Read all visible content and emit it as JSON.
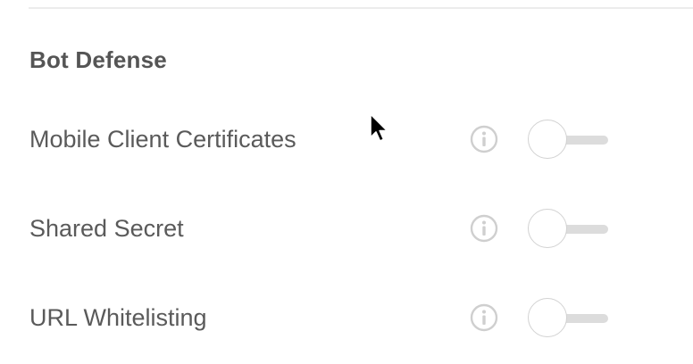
{
  "section": {
    "title": "Bot Defense"
  },
  "settings": [
    {
      "label": "Mobile Client Certificates",
      "enabled": false,
      "info_icon": "info-circle-icon"
    },
    {
      "label": "Shared Secret",
      "enabled": false,
      "info_icon": "info-circle-icon"
    },
    {
      "label": "URL Whitelisting",
      "enabled": false,
      "info_icon": "info-circle-icon"
    }
  ],
  "colors": {
    "text": "#5a5a5a",
    "title": "#555555",
    "icon": "#cfcfcf",
    "toggle_track": "#dcdcdc",
    "toggle_knob_border": "#d2d2d2"
  },
  "cursor_icon": "mouse-pointer-icon"
}
